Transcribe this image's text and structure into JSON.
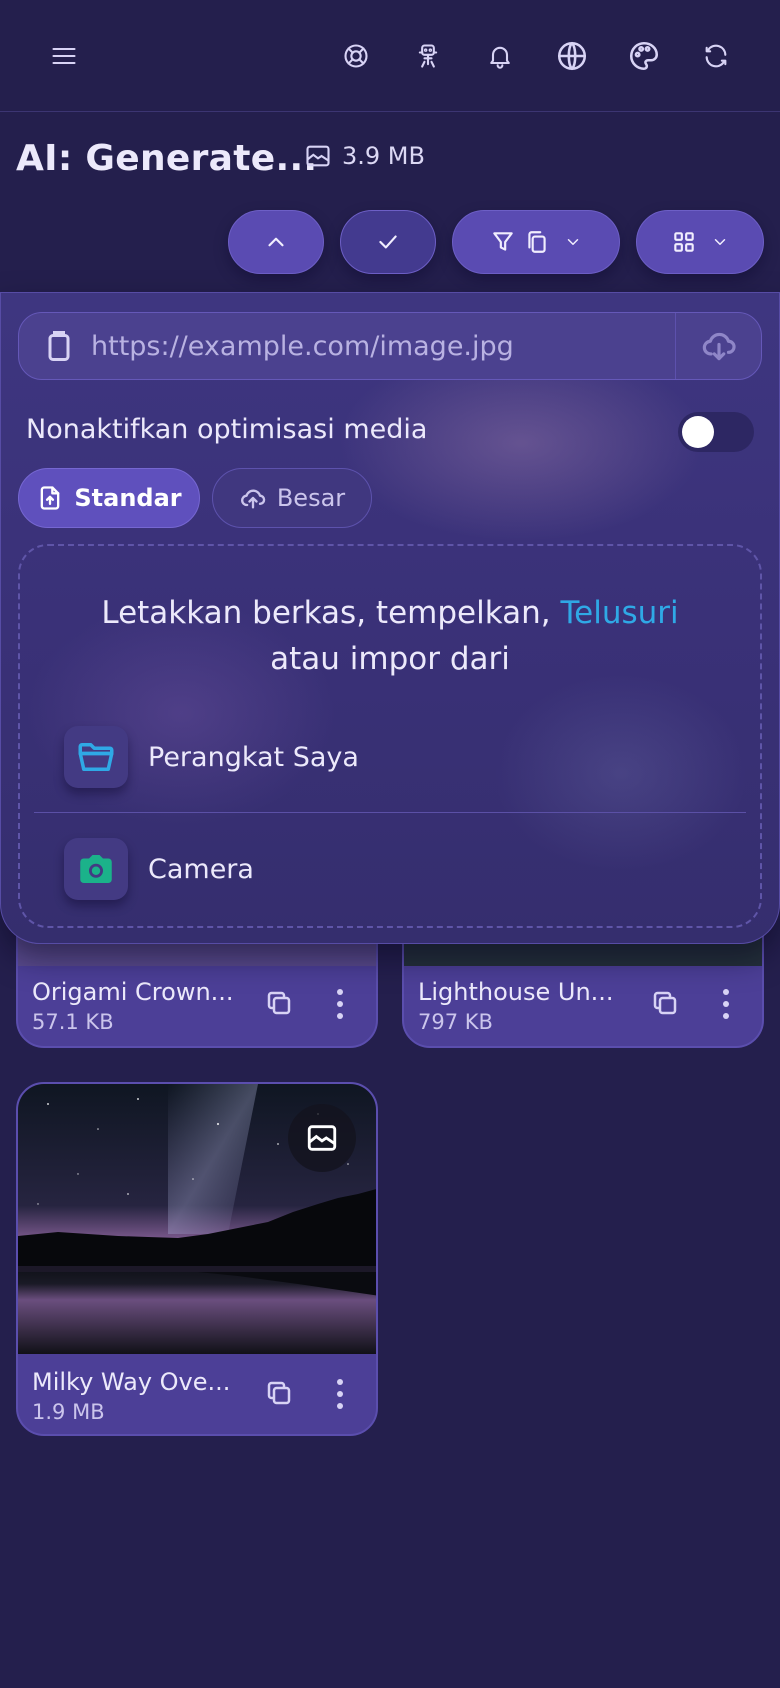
{
  "header": {
    "icons": [
      "menu-icon",
      "lifebuoy-icon",
      "robot-icon",
      "bell-icon",
      "globe-icon",
      "palette-icon",
      "refresh-icon"
    ]
  },
  "title_bar": {
    "title": "AI: Generate...",
    "total_size": "3.9 MB",
    "size_icon": "image-icon"
  },
  "toolbar": {
    "buttons": [
      "collapse-button",
      "select-button",
      "filter-button",
      "view-button"
    ]
  },
  "upload": {
    "url_placeholder": "https://example.com/image.jpg",
    "optimization_label": "Nonaktifkan optimisasi media",
    "optimization_disabled": false,
    "modes": [
      {
        "label": "Standar",
        "active": true
      },
      {
        "label": "Besar",
        "active": false
      }
    ],
    "drop_text_before": "Letakkan berkas, tempelkan, ",
    "drop_link": "Telusuri",
    "drop_text_after": "atau impor dari",
    "sources": [
      {
        "label": "Perangkat Saya",
        "icon": "folder-icon",
        "color": "#2fa9e6"
      },
      {
        "label": "Camera",
        "icon": "camera-icon",
        "color": "#1bb28a"
      }
    ]
  },
  "files": [
    {
      "name": "Origami Crown...",
      "size": "57.1 KB"
    },
    {
      "name": "Lighthouse Un...",
      "size": "797 KB"
    },
    {
      "name": "Milky Way Ove...",
      "size": "1.9 MB"
    }
  ],
  "colors": {
    "background": "#241f4d",
    "accent": "#5a4bb2",
    "link": "#2fa9e6"
  }
}
